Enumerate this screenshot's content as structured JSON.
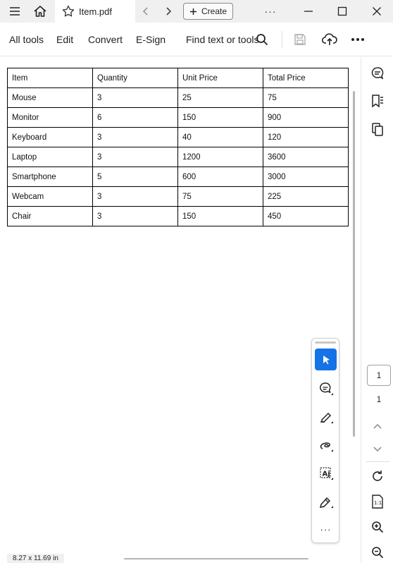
{
  "titlebar": {
    "tab_title": "Item.pdf",
    "create_label": "Create",
    "more_label": "···"
  },
  "menubar": {
    "items": [
      "All tools",
      "Edit",
      "Convert",
      "E-Sign"
    ],
    "find_label": "Find text or tools"
  },
  "table": {
    "headers": [
      "Item",
      "Quantity",
      "Unit Price",
      "Total Price"
    ],
    "rows": [
      [
        "Mouse",
        "3",
        "25",
        "75"
      ],
      [
        "Monitor",
        "6",
        "150",
        "900"
      ],
      [
        "Keyboard",
        "3",
        "40",
        "120"
      ],
      [
        "Laptop",
        "3",
        "1200",
        "3600"
      ],
      [
        "Smartphone",
        "5",
        "600",
        "3000"
      ],
      [
        "Webcam",
        "3",
        "75",
        "225"
      ],
      [
        "Chair",
        "3",
        "150",
        "450"
      ]
    ]
  },
  "pager": {
    "current_page": "1",
    "total_pages": "1"
  },
  "status": {
    "page_size": "8.27 x 11.69 in"
  },
  "colors": {
    "accent": "#1473e6",
    "chrome_bg": "#f0f0f0"
  },
  "floating_tools": {
    "more_label": "···"
  }
}
